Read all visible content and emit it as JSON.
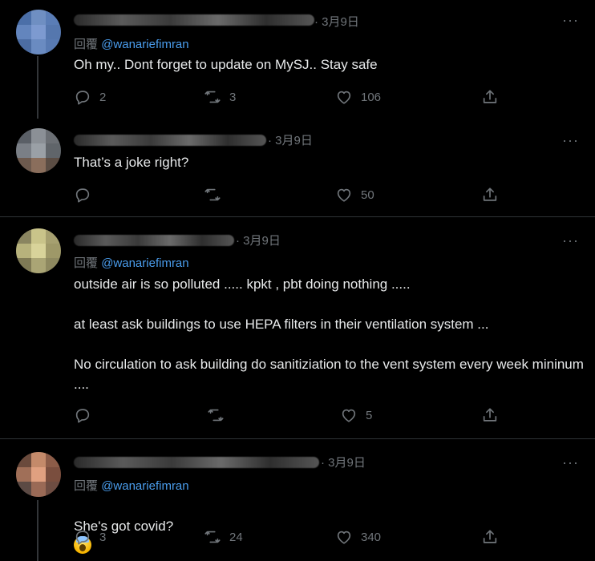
{
  "tweets": [
    {
      "date": "· 3月9日",
      "reply_prefix": "回覆",
      "reply_handle": "@wanariefimran",
      "text": "Oh my.. Dont forget to update on MySJ.. Stay safe",
      "replies": "2",
      "retweets": "3",
      "likes": "106",
      "more": "···"
    },
    {
      "date": "· 3月9日",
      "text": "That’s a joke right?",
      "replies": "",
      "retweets": "",
      "likes": "50",
      "more": "···"
    },
    {
      "date": "· 3月9日",
      "reply_prefix": "回覆",
      "reply_handle": "@wanariefimran",
      "text": "outside air is so polluted ..... kpkt , pbt doing nothing .....\n\nat least ask buildings to use HEPA filters in their ventilation system ...\n\nNo circulation to ask building do sanitiziation to the vent system every week mininum ....",
      "replies": "",
      "retweets": "",
      "likes": "5",
      "more": "···"
    },
    {
      "date": "· 3月9日",
      "reply_prefix": "回覆",
      "reply_handle": "@wanariefimran",
      "text": "She's got covid?",
      "emoji": "face-screaming-in-fear-emoji",
      "replies": "3",
      "retweets": "24",
      "likes": "340",
      "more": "···"
    }
  ],
  "icons": {
    "reply": "reply-icon",
    "retweet": "retweet-icon",
    "like": "heart-icon",
    "share": "share-icon"
  },
  "colors": {
    "background": "#000000",
    "text": "#e7e9ea",
    "secondary": "#71767b",
    "link": "#4a9ded",
    "divider": "#2f3336"
  }
}
